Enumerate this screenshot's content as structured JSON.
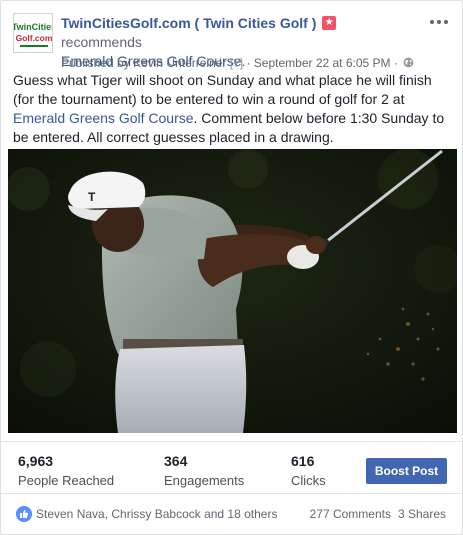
{
  "header": {
    "page_name": "TwinCitiesGolf.com ( Twin Cities Golf )",
    "recommends": "recommends",
    "place": "Emerald Greens Golf Course.",
    "published_by": "Published by Kevin Unterreiner",
    "help_mark": "[?]",
    "separator": "·",
    "date": "September 22 at 6:05 PM",
    "logo_text_top": "TwinCities",
    "logo_text_bottom": "Golf.com"
  },
  "post": {
    "text_part1": "Guess what Tiger will shoot on Sunday and what place he will finish (for the tournament) to be entered to win a round of golf for 2 at ",
    "text_link": "Emerald Greens Golf Course",
    "text_part2": ". Comment below before 1:30 Sunday to be entered. All correct guesses placed in a drawing."
  },
  "stats": {
    "reached_value": "6,963",
    "reached_label": "People Reached",
    "engagements_value": "364",
    "engagements_label": "Engagements",
    "clicks_value": "616",
    "clicks_label": "Clicks",
    "boost_label": "Boost Post"
  },
  "footer": {
    "likers": "Steven Nava, Chrissy Babcock and 18 others",
    "comments": "277 Comments",
    "shares": "3 Shares"
  },
  "colors": {
    "link": "#385898",
    "boost": "#4267b2",
    "recommend_badge": "#f35369",
    "like": "#5890ff"
  },
  "icons": [
    "recommend-star-icon",
    "globe-icon",
    "more-options-icon",
    "like-thumb-icon"
  ]
}
